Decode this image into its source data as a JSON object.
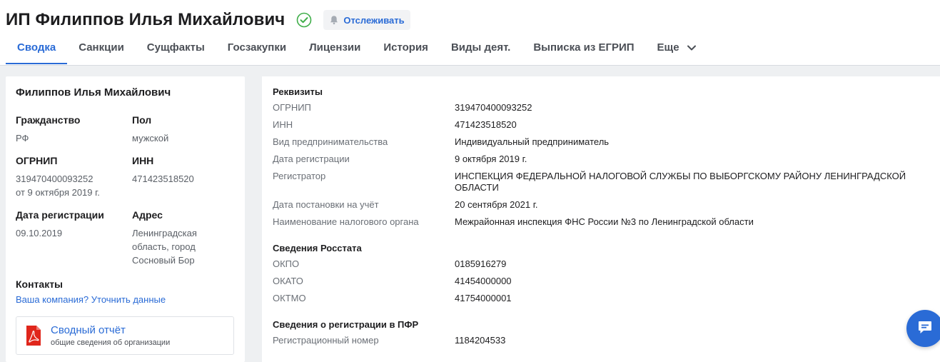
{
  "header": {
    "title": "ИП Филиппов Илья Михайлович",
    "track_label": "Отслеживать"
  },
  "tabs": [
    {
      "label": "Сводка",
      "active": true
    },
    {
      "label": "Санкции"
    },
    {
      "label": "Сущфакты"
    },
    {
      "label": "Госзакупки"
    },
    {
      "label": "Лицензии"
    },
    {
      "label": "История"
    },
    {
      "label": "Виды деят."
    },
    {
      "label": "Выписка из ЕГРИП"
    },
    {
      "label": "Еще"
    }
  ],
  "summary": {
    "name": "Филиппов Илья Михайлович",
    "citizenship_label": "Гражданство",
    "citizenship_value": "РФ",
    "sex_label": "Пол",
    "sex_value": "мужской",
    "ogrnip_label": "ОГРНИП",
    "ogrnip_value": "319470400093252",
    "ogrnip_date": "от 9 октября 2019 г.",
    "inn_label": "ИНН",
    "inn_value": "471423518520",
    "reg_date_label": "Дата регистрации",
    "reg_date_value": "09.10.2019",
    "address_label": "Адрес",
    "address_value_1": "Ленинградская",
    "address_value_2": "область, город",
    "address_value_3": "Сосновый Бор",
    "contacts_label": "Контакты",
    "contacts_link": "Ваша компания? Уточнить данные",
    "report_title": "Сводный отчёт",
    "report_subtitle": "общие сведения об организации"
  },
  "details": {
    "requisites_title": "Реквизиты",
    "requisites": [
      {
        "k": "ОГРНИП",
        "v": "319470400093252"
      },
      {
        "k": "ИНН",
        "v": "471423518520"
      },
      {
        "k": "Вид предпринимательства",
        "v": "Индивидуальный предприниматель"
      },
      {
        "k": "Дата регистрации",
        "v": "9 октября 2019 г."
      },
      {
        "k": "Регистратор",
        "v": "ИНСПЕКЦИЯ ФЕДЕРАЛЬНОЙ НАЛОГОВОЙ СЛУЖБЫ ПО ВЫБОРГСКОМУ РАЙОНУ ЛЕНИНГРАДСКОЙ ОБЛАСТИ"
      },
      {
        "k": "Дата постановки на учёт",
        "v": "20 сентября 2021 г."
      },
      {
        "k": "Наименование налогового органа",
        "v": "Межрайонная инспекция ФНС России №3 по Ленинградской области"
      }
    ],
    "rosstat_title": "Сведения Росстата",
    "rosstat": [
      {
        "k": "ОКПО",
        "v": "0185916279"
      },
      {
        "k": "ОКАТО",
        "v": "41454000000"
      },
      {
        "k": "ОКТМО",
        "v": "41754000001"
      }
    ],
    "pfr_title": "Сведения о регистрации в ПФР",
    "pfr": [
      {
        "k": "Регистрационный номер",
        "v": "1184204533"
      }
    ]
  },
  "colors": {
    "accent": "#2a6bd6",
    "verified": "#3fae49",
    "pdf": "#e0261b"
  },
  "icons": [
    "check-circle-icon",
    "bell-icon",
    "chevron-down-icon",
    "pdf-icon",
    "chat-icon"
  ]
}
